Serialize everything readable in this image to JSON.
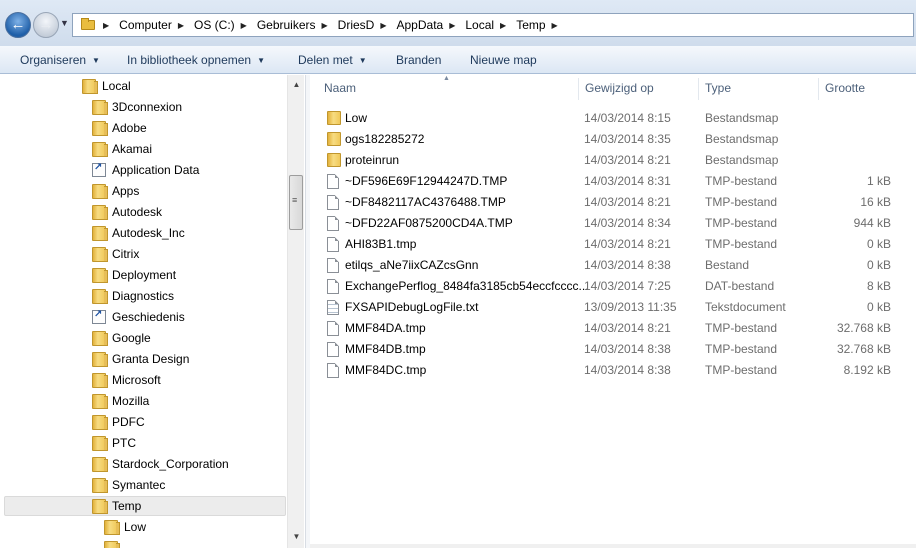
{
  "breadcrumb": [
    "Computer",
    "OS (C:)",
    "Gebruikers",
    "DriesD",
    "AppData",
    "Local",
    "Temp"
  ],
  "toolbar": {
    "organize": "Organiseren",
    "library": "In bibliotheek opnemen",
    "share": "Delen met",
    "burn": "Branden",
    "new_folder": "Nieuwe map"
  },
  "nav": {
    "root": "Local",
    "items": [
      {
        "label": "3Dconnexion",
        "icon": "folder-icon"
      },
      {
        "label": "Adobe",
        "icon": "folder-icon"
      },
      {
        "label": "Akamai",
        "icon": "folder-icon"
      },
      {
        "label": "Application Data",
        "icon": "shortcut-folder-icon"
      },
      {
        "label": "Apps",
        "icon": "folder-icon"
      },
      {
        "label": "Autodesk",
        "icon": "folder-icon"
      },
      {
        "label": "Autodesk_Inc",
        "icon": "folder-icon"
      },
      {
        "label": "Citrix",
        "icon": "folder-icon"
      },
      {
        "label": "Deployment",
        "icon": "folder-icon"
      },
      {
        "label": "Diagnostics",
        "icon": "folder-icon"
      },
      {
        "label": "Geschiedenis",
        "icon": "shortcut-folder-icon"
      },
      {
        "label": "Google",
        "icon": "folder-icon"
      },
      {
        "label": "Granta Design",
        "icon": "folder-icon"
      },
      {
        "label": "Microsoft",
        "icon": "folder-icon"
      },
      {
        "label": "Mozilla",
        "icon": "folder-icon"
      },
      {
        "label": "PDFC",
        "icon": "folder-icon"
      },
      {
        "label": "PTC",
        "icon": "folder-icon"
      },
      {
        "label": "Stardock_Corporation",
        "icon": "folder-icon"
      },
      {
        "label": "Symantec",
        "icon": "folder-icon"
      },
      {
        "label": "Temp",
        "icon": "folder-icon",
        "selected": true
      }
    ],
    "child": "Low"
  },
  "columns": {
    "name": "Naam",
    "date": "Gewijzigd op",
    "type": "Type",
    "size": "Grootte"
  },
  "files": [
    {
      "name": "Low",
      "date": "14/03/2014 8:15",
      "type": "Bestandsmap",
      "size": "",
      "icon": "folder"
    },
    {
      "name": "ogs182285272",
      "date": "14/03/2014 8:35",
      "type": "Bestandsmap",
      "size": "",
      "icon": "folder"
    },
    {
      "name": "proteinrun",
      "date": "14/03/2014 8:21",
      "type": "Bestandsmap",
      "size": "",
      "icon": "folder"
    },
    {
      "name": "~DF596E69F12944247D.TMP",
      "date": "14/03/2014 8:31",
      "type": "TMP-bestand",
      "size": "1 kB",
      "icon": "file"
    },
    {
      "name": "~DF8482117AC4376488.TMP",
      "date": "14/03/2014 8:21",
      "type": "TMP-bestand",
      "size": "16 kB",
      "icon": "file"
    },
    {
      "name": "~DFD22AF0875200CD4A.TMP",
      "date": "14/03/2014 8:34",
      "type": "TMP-bestand",
      "size": "944 kB",
      "icon": "file"
    },
    {
      "name": "AHI83B1.tmp",
      "date": "14/03/2014 8:21",
      "type": "TMP-bestand",
      "size": "0 kB",
      "icon": "file"
    },
    {
      "name": "etilqs_aNe7iixCAZcsGnn",
      "date": "14/03/2014 8:38",
      "type": "Bestand",
      "size": "0 kB",
      "icon": "file"
    },
    {
      "name": "ExchangePerflog_8484fa3185cb54eccfcccc...",
      "date": "14/03/2014 7:25",
      "type": "DAT-bestand",
      "size": "8 kB",
      "icon": "file"
    },
    {
      "name": "FXSAPIDebugLogFile.txt",
      "date": "13/09/2013 11:35",
      "type": "Tekstdocument",
      "size": "0 kB",
      "icon": "text"
    },
    {
      "name": "MMF84DA.tmp",
      "date": "14/03/2014 8:21",
      "type": "TMP-bestand",
      "size": "32.768 kB",
      "icon": "file"
    },
    {
      "name": "MMF84DB.tmp",
      "date": "14/03/2014 8:38",
      "type": "TMP-bestand",
      "size": "32.768 kB",
      "icon": "file"
    },
    {
      "name": "MMF84DC.tmp",
      "date": "14/03/2014 8:38",
      "type": "TMP-bestand",
      "size": "8.192 kB",
      "icon": "file"
    }
  ]
}
